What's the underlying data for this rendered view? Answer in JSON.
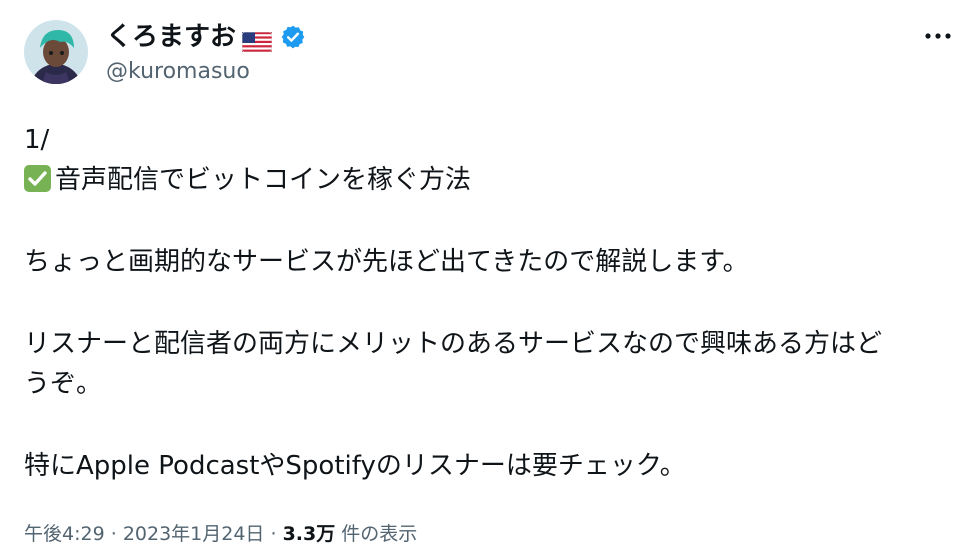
{
  "tweet": {
    "author_name": "くろますお",
    "author_flag": "us-flag",
    "verified": true,
    "author_handle": "@kuromasuo",
    "lines": {
      "l1": "1/",
      "l2": "音声配信でビットコインを稼ぐ方法",
      "l3": "ちょっと画期的なサービスが先ほど出てきたので解説します。",
      "l4": "リスナーと配信者の両方にメリットのあるサービスなので興味ある方はど",
      "l5": "うぞ。",
      "l6": "特にApple PodcastやSpotifyのリスナーは要チェック。"
    },
    "time": "午後4:29",
    "separator": "·",
    "date": "2023年1月24日",
    "views_count": "3.3万",
    "views_label": "件の表示"
  },
  "icons": {
    "avatar": "avatar-image",
    "verified": "verified-badge-icon",
    "flag": "us-flag-icon",
    "more": "more-options-icon",
    "check": "check-mark-emoji"
  },
  "colors": {
    "text": "#0f1419",
    "secondary": "#536471",
    "verified": "#1d9bf0",
    "check": "#77b255"
  }
}
